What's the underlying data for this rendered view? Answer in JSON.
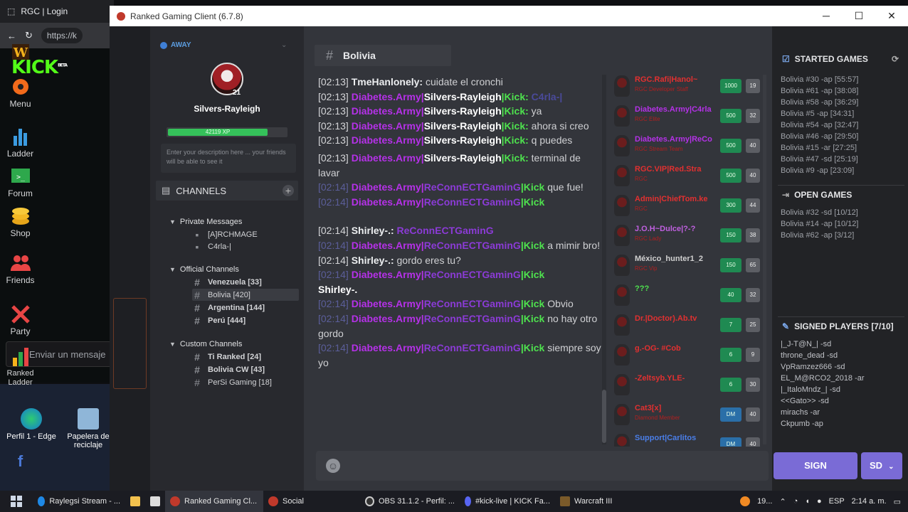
{
  "browser": {
    "tab_title": "RGC | Login",
    "url": "https://k",
    "chat_placeholder": "Enviar un mensaje"
  },
  "desktop": {
    "icon1": "Perfil 1 - Edge",
    "icon2": "Papelera de reciclaje"
  },
  "window": {
    "title": "Ranked Gaming Client (6.7.8)",
    "min": "─",
    "max": "☐",
    "close": "✕"
  },
  "nav": {
    "menu": "Menu",
    "ladder": "Ladder",
    "forum": "Forum",
    "shop": "Shop",
    "friends": "Friends",
    "party": "Party",
    "ranked_ladder": "Ranked Ladder"
  },
  "profile": {
    "status": "AWAY",
    "name": "Silvers-Rayleigh",
    "level": "21",
    "xp": "42119 XP",
    "description_placeholder": "Enter your description here ... your friends will be able to see it"
  },
  "channels": {
    "header": "CHANNELS",
    "private": {
      "label": "Private Messages",
      "items": [
        "[A]RCHMAGE",
        "C4rla-|"
      ]
    },
    "official": {
      "label": "Official Channels",
      "items": [
        "Venezuela [33]",
        "Bolivia [420]",
        "Argentina [144]",
        "Perú [444]"
      ]
    },
    "custom": {
      "label": "Custom Channels",
      "items": [
        "Ti Ranked [24]",
        "Bolivia CW [43]",
        "PerSi Gaming [18]"
      ]
    }
  },
  "chat": {
    "channel": "Bolivia",
    "messages": [
      {
        "ts": "[02:13]",
        "user": "TmeHanlonely:",
        "text": "cuidate el cronchi"
      },
      {
        "ts": "[02:13]",
        "clan": "Diabetes.Army|",
        "user": "Silvers-Rayleigh",
        "tag": "|Kick:",
        "text": "C4rla-|"
      },
      {
        "ts": "[02:13]",
        "clan": "Diabetes.Army|",
        "user": "Silvers-Rayleigh",
        "tag": "|Kick:",
        "text": "ya"
      },
      {
        "ts": "[02:13]",
        "clan": "Diabetes.Army|",
        "user": "Silvers-Rayleigh",
        "tag": "|Kick:",
        "text": "ahora si creo"
      },
      {
        "ts": "[02:13]",
        "clan": "Diabetes.Army|",
        "user": "Silvers-Rayleigh",
        "tag": "|Kick:",
        "text": "q puedes"
      },
      {
        "ts": "[02:13]",
        "clan": "Diabetes.Army|",
        "user": "Silvers-Rayleigh",
        "tag": "|Kick:",
        "text": "terminal de lavar"
      },
      {
        "ts": "[02:14]",
        "clan": "Diabetes.Army|",
        "user": "ReConnECTGaminG",
        "tag": "|Kick",
        "text": "que fue!"
      },
      {
        "ts": "[02:14]",
        "clan": "Diabetes.Army|",
        "user": "ReConnECTGaminG",
        "tag": "|Kick",
        "text": ""
      },
      {
        "ts": "[02:14]",
        "user": "Shirley-.:",
        "text": "ReConnECTGaminG"
      },
      {
        "ts": "[02:14]",
        "clan": "Diabetes.Army|",
        "user": "ReConnECTGaminG",
        "tag": "|Kick",
        "text": "a mimir bro!"
      },
      {
        "ts": "[02:14]",
        "user": "Shirley-.:",
        "text": "gordo eres tu?"
      },
      {
        "ts": "[02:14]",
        "clan": "Diabetes.Army|",
        "user": "ReConnECTGaminG",
        "tag": "|Kick",
        "text": "Shirley-."
      },
      {
        "ts": "[02:14]",
        "clan": "Diabetes.Army|",
        "user": "ReConnECTGaminG",
        "tag": "|Kick",
        "text": "Obvio"
      },
      {
        "ts": "[02:14]",
        "clan": "Diabetes.Army|",
        "user": "ReConnECTGaminG",
        "tag": "|Kick",
        "text": "no hay otro gordo"
      },
      {
        "ts": "[02:14]",
        "clan": "Diabetes.Army|",
        "user": "ReConnECTGaminG",
        "tag": "|Kick",
        "text": "siempre soy yo"
      }
    ]
  },
  "users": [
    {
      "name": "RGC.Rafi|Hanol~",
      "sub": "RGC Developer Staff",
      "b1": "1000",
      "b2": "19",
      "color": "#e23030"
    },
    {
      "name": "Diabetes.Army|C4rla",
      "sub": "RGC Elite",
      "b1": "500",
      "b2": "32",
      "color": "#b531e8"
    },
    {
      "name": "Diabetes.Army|ReCo",
      "sub": "RGC Stream Team",
      "b1": "500",
      "b2": "40",
      "color": "#b531e8"
    },
    {
      "name": "RGC.VIP|Red.Stra",
      "sub": "RGC",
      "b1": "500",
      "b2": "40",
      "color": "#e23030"
    },
    {
      "name": "Admin|ChiefTom.ke",
      "sub": "RGC",
      "b1": "300",
      "b2": "44",
      "color": "#e23030"
    },
    {
      "name": "J.O.H~Dulce|?-?",
      "sub": "RGC Lady",
      "b1": "150",
      "b2": "38",
      "color": "#c060e0"
    },
    {
      "name": "México_hunter1_2",
      "sub": "RGC Vip",
      "b1": "150",
      "b2": "65",
      "color": "#d0d0d0"
    },
    {
      "name": "???",
      "sub": "",
      "b1": "40",
      "b2": "32",
      "color": "#4ee24e"
    },
    {
      "name": "Dr.|Doctor).Ab.tv",
      "sub": "",
      "b1": "7",
      "b2": "25",
      "color": "#e23030"
    },
    {
      "name": "g.-OG- #Cob",
      "sub": "",
      "b1": "6",
      "b2": "9",
      "color": "#e23030"
    },
    {
      "name": "-Zeltsyb.YLE-",
      "sub": "",
      "b1": "6",
      "b2": "30",
      "color": "#e23030"
    },
    {
      "name": "Cat3[x]",
      "sub": "Diamond Member",
      "b1": "DM",
      "b2": "40",
      "color": "#e23030"
    },
    {
      "name": "Support|Carlitos",
      "sub": "",
      "b1": "DM",
      "b2": "40",
      "color": "#4a7ee8"
    }
  ],
  "started_games": {
    "header": "STARTED GAMES",
    "items": [
      "Bolivia #30 -ap [55:57]",
      "Bolivia #61 -ap [38:08]",
      "Bolivia #58 -ap [36:29]",
      "Bolivia #5 -ap [34:31]",
      "Bolivia #54 -ap [32:47]",
      "Bolivia #46 -ap [29:50]",
      "Bolivia #15 -ar [27:25]",
      "Bolivia #47 -sd [25:19]",
      "Bolivia #9 -ap [23:09]"
    ]
  },
  "open_games": {
    "header": "OPEN GAMES",
    "items": [
      "Bolivia #32 -sd [10/12]",
      "Bolivia #14 -ap [10/12]",
      "Bolivia #62 -ap [3/12]"
    ]
  },
  "signed_players": {
    "header": "SIGNED PLAYERS [7/10]",
    "items": [
      "|_J-T@N_| -sd",
      "throne_dead -sd",
      "VpRamzez666 -sd",
      "EL_M@RCO2_2018 -ar",
      "|_ItaloMndz_| -sd",
      "<<Gato>> -sd",
      "mirachs -ar",
      "Ckpumb -ap"
    ]
  },
  "buttons": {
    "sign": "SIGN",
    "sd": "SD"
  },
  "taskbar": {
    "items": [
      "Raylegsi Stream - ...",
      "Ranked Gaming Cl...",
      "Social",
      "OBS 31.1.2 - Perfil: ...",
      "#kick-live | KICK Fa...",
      "Warcraft III"
    ],
    "temp": "19...",
    "lang": "ESP",
    "time": "2:14 a. m."
  }
}
